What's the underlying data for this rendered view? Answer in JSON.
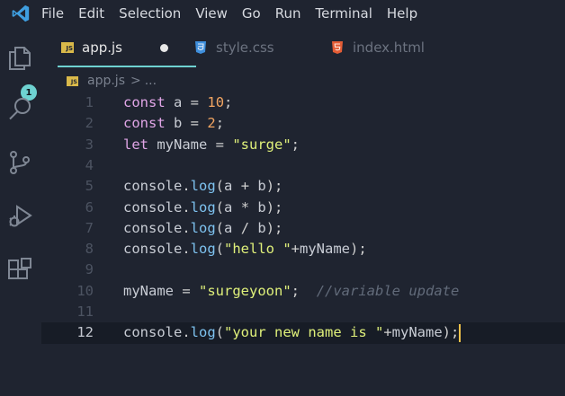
{
  "menu": [
    "File",
    "Edit",
    "Selection",
    "View",
    "Go",
    "Run",
    "Terminal",
    "Help"
  ],
  "activity": {
    "badge_count": "1"
  },
  "tabs": [
    {
      "label": "app.js",
      "icon": "js-file-icon",
      "active": true,
      "unsaved": true
    },
    {
      "label": "style.css",
      "icon": "css-file-icon",
      "active": false
    },
    {
      "label": "index.html",
      "icon": "html-file-icon",
      "active": false
    }
  ],
  "breadcrumb": {
    "file": "app.js",
    "separator": ">",
    "rest": "..."
  },
  "icon_labels": {
    "js": "JS"
  },
  "editor": {
    "current_line": 12,
    "lines": [
      {
        "number": "1",
        "code": "const a = 10;"
      },
      {
        "number": "2",
        "code": "const b = 2;"
      },
      {
        "number": "3",
        "code": "let myName = \"surge\";"
      },
      {
        "number": "4",
        "code": ""
      },
      {
        "number": "5",
        "code": "console.log(a + b);"
      },
      {
        "number": "6",
        "code": "console.log(a * b);"
      },
      {
        "number": "7",
        "code": "console.log(a / b);"
      },
      {
        "number": "8",
        "code": "console.log(\"hello \"+myName);"
      },
      {
        "number": "9",
        "code": ""
      },
      {
        "number": "10",
        "code": "myName = \"surgeyoon\";  //variable update"
      },
      {
        "number": "11",
        "code": ""
      },
      {
        "number": "12",
        "code": "console.log(\"your new name is \"+myName);"
      }
    ]
  },
  "colors": {
    "background": "#1f2430",
    "accent": "#6ed2d1",
    "keyword": "#e0a5e6",
    "number": "#f2a562",
    "string": "#dff07a",
    "function": "#7ec3f0",
    "comment": "#626b7a",
    "cursor": "#f0c24a"
  }
}
